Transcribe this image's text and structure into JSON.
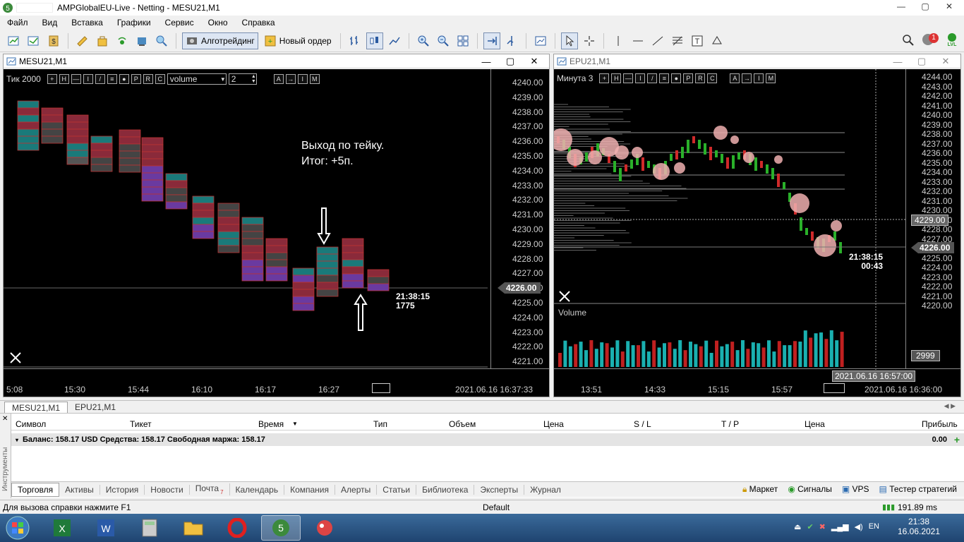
{
  "window": {
    "title": "AMPGlobalEU-Live - Netting - MESU21,M1",
    "controls": {
      "minimize": "—",
      "maximize": "▢",
      "close": "✕"
    }
  },
  "menu": [
    "Файл",
    "Вид",
    "Вставка",
    "Графики",
    "Сервис",
    "Окно",
    "Справка"
  ],
  "toolbar": {
    "algo_label": "Алготрейдинг",
    "new_order_label": "Новый ордер",
    "notif_count": "1",
    "lvl": "LVL"
  },
  "left_chart": {
    "title": "MESU21,M1",
    "mode_label": "Тик  2000",
    "select_value": "volume",
    "number_value": "2",
    "annotation_line1": "Выход по тейку.",
    "annotation_line2": "Итог: +5п.",
    "countdown_time": "21:38:15",
    "countdown_value": "1775",
    "current_price": "4226.00",
    "price_labels": [
      "4240.00",
      "4239.00",
      "4238.00",
      "4237.00",
      "4236.00",
      "4235.00",
      "4234.00",
      "4233.00",
      "4232.00",
      "4231.00",
      "4230.00",
      "4229.00",
      "4228.00",
      "4227.00",
      "4226.00",
      "4225.00",
      "4224.00",
      "4223.00",
      "4222.00",
      "4221.00"
    ],
    "time_labels": [
      "5:08",
      "15:30",
      "15:44",
      "16:10",
      "16:17",
      "16:27"
    ],
    "datetime": "2021.06.16 16:37:33",
    "toolbar_buttons": [
      "+",
      "H",
      "—",
      "I",
      "/",
      "≡",
      "●",
      "P",
      "R",
      "C"
    ],
    "right_buttons": [
      "A",
      "→",
      "I",
      "M"
    ]
  },
  "right_chart": {
    "title": "EPU21,M1",
    "mode_label": "Минута  3",
    "current_price": "4226.00",
    "crosshair_price": "4229.00",
    "countdown_time": "21:38:15",
    "countdown_value": "00:43",
    "volume_label": "Volume",
    "volume_value": "2999",
    "crosshair_time": "2021.06.16 16:57:00",
    "price_labels": [
      "4244.00",
      "4243.00",
      "4242.00",
      "4241.00",
      "4240.00",
      "4239.00",
      "4238.00",
      "4237.00",
      "4236.00",
      "4235.00",
      "4234.00",
      "4233.00",
      "4232.00",
      "4231.00",
      "4230.00",
      "4229.00",
      "4228.00",
      "4227.00",
      "4226.00",
      "4225.00",
      "4224.00",
      "4223.00",
      "4222.00",
      "4221.00",
      "4220.00"
    ],
    "time_labels": [
      "13:51",
      "14:33",
      "15:15",
      "15:57"
    ],
    "datetime": "2021.06.16 16:36:00",
    "toolbar_buttons": [
      "+",
      "H",
      "—",
      "I",
      "/",
      "≡",
      "●",
      "P",
      "R",
      "C"
    ],
    "right_buttons": [
      "A",
      "→",
      "I",
      "M"
    ]
  },
  "chart_tabs": [
    "MESU21,M1",
    "EPU21,M1"
  ],
  "terminal": {
    "side_label": "Инструменты",
    "columns": [
      "Символ",
      "Тикет",
      "Время",
      "Тип",
      "Объем",
      "Цена",
      "S / L",
      "T / P",
      "Цена",
      "Прибыль"
    ],
    "balance_text": "Баланс: 158.17 USD  Средства: 158.17  Свободная маржа: 158.17",
    "profit": "0.00",
    "tabs": [
      "Торговля",
      "Активы",
      "История",
      "Новости",
      "Почта",
      "Календарь",
      "Компания",
      "Алерты",
      "Статьи",
      "Библиотека",
      "Эксперты",
      "Журнал"
    ],
    "mail_count": "7",
    "right_links": [
      "Маркет",
      "Сигналы",
      "VPS",
      "Тестер стратегий"
    ]
  },
  "status": {
    "help": "Для вызова справки нажмите F1",
    "profile": "Default",
    "ping": "191.89 ms"
  },
  "taskbar": {
    "time": "21:38",
    "date": "16.06.2021"
  }
}
